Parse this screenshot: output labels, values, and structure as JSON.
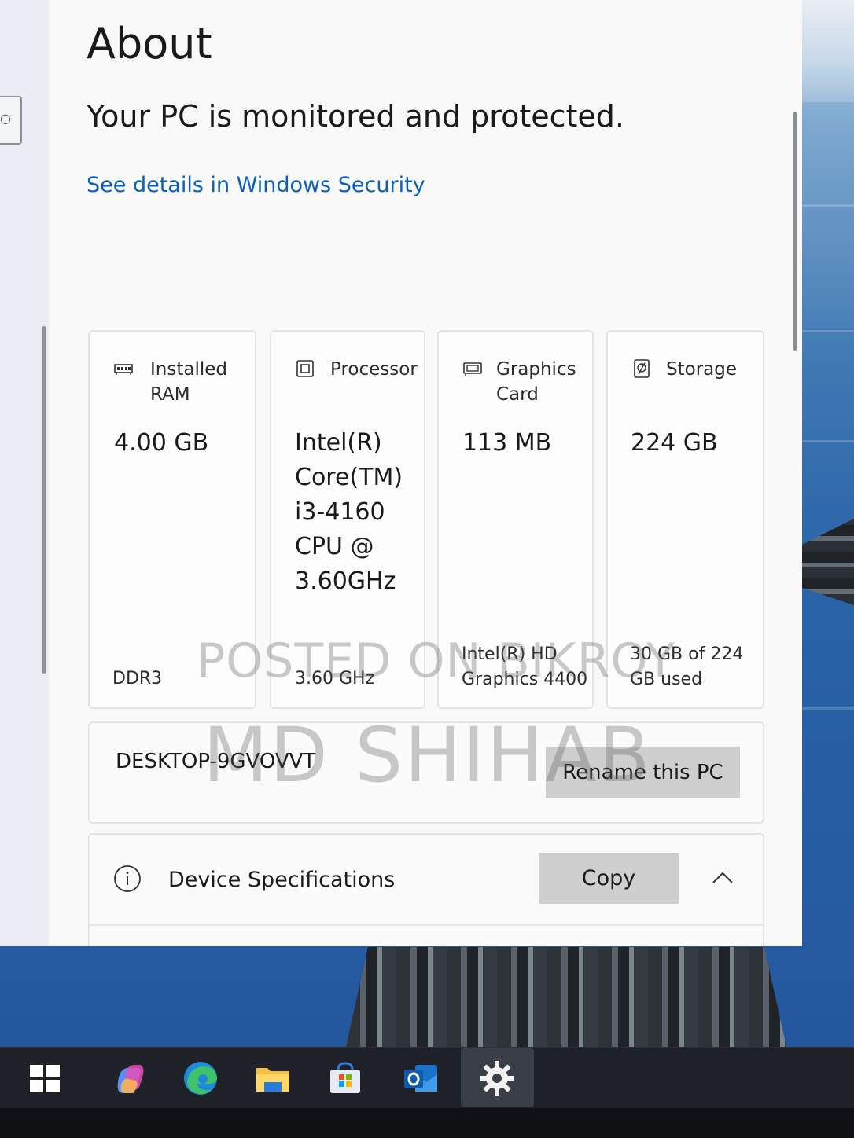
{
  "page": {
    "title": "About",
    "protection_status": "Your PC is monitored and protected.",
    "security_link": "See details in Windows Security"
  },
  "specs": [
    {
      "icon": "ram-icon",
      "label_line1": "Installed",
      "label_line2": "RAM",
      "value_lines": [
        "4.00 GB"
      ],
      "sub_lines": [
        "DDR3"
      ]
    },
    {
      "icon": "processor-icon",
      "label_line1": "Processor",
      "label_line2": "",
      "value_lines": [
        "Intel(R)",
        "Core(TM)",
        "i3-4160",
        "CPU @",
        "3.60GHz"
      ],
      "sub_lines": [
        "3.60 GHz"
      ]
    },
    {
      "icon": "graphics-card-icon",
      "label_line1": "Graphics",
      "label_line2": "Card",
      "value_lines": [
        "113 MB"
      ],
      "sub_lines": [
        "Intel(R) HD",
        "Graphics 4400"
      ]
    },
    {
      "icon": "storage-icon",
      "label_line1": "Storage",
      "label_line2": "",
      "value_lines": [
        "224 GB"
      ],
      "sub_lines": [
        "30 GB of 224",
        "GB used"
      ]
    }
  ],
  "pc": {
    "name": "DESKTOP-9GVOVVT",
    "rename_label": "Rename this PC"
  },
  "device_specs": {
    "title": "Device Specifications",
    "copy_label": "Copy",
    "expanded": true
  },
  "watermark": {
    "line1": "POSTED ON BIKROY",
    "line2": "MD SHIHAB"
  },
  "taskbar": {
    "items": [
      "windows-start-icon",
      "copilot-icon",
      "edge-icon",
      "file-explorer-icon",
      "microsoft-store-icon",
      "outlook-icon",
      "settings-gear-icon"
    ],
    "active": "settings-gear-icon"
  },
  "colors": {
    "link": "#0a5fb8",
    "button": "#cfcfcf",
    "taskbar": "#1e2127",
    "window_bg": "#f9f9f9"
  }
}
